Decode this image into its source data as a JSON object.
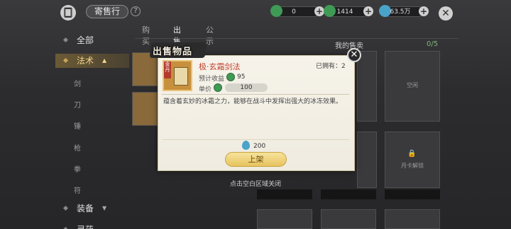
{
  "header": {
    "logo_glyph": "🀆",
    "title": "寄售行",
    "help": "?",
    "currencies": [
      {
        "name": "jade",
        "value": "0",
        "color": "#3f9a56"
      },
      {
        "name": "copper",
        "value": "1414",
        "color": "#3f9a56"
      },
      {
        "name": "spirit-stone",
        "value": "63.5万",
        "color": "#4aa3c9"
      }
    ],
    "plus": "+",
    "close": "✕"
  },
  "sidebar": {
    "all": "全部",
    "spells": "法术",
    "subs": [
      "剑",
      "刀",
      "锤",
      "枪",
      "拳",
      "符"
    ],
    "equipment": "装备",
    "other": "灵药"
  },
  "tabs": [
    "购买",
    "出售",
    "公示"
  ],
  "my_sell_label": "我的售卖",
  "sell_count": "0/5",
  "slot_texts": {
    "unlock_month": "月卡解锁",
    "empty": "空闲"
  },
  "modal": {
    "title": "出售物品",
    "item_badge": "金丹",
    "item_name": "极·玄霜剑法",
    "owned_label": "已拥有：",
    "owned_value": "2",
    "expected_label": "预计收益",
    "expected_value": "95",
    "price_label": "单价",
    "price_value": "100",
    "description": "蕴含着玄妙的冰霜之力，能够在战斗中发挥出强大的冰冻效果。",
    "fee_value": "200",
    "list_button": "上架",
    "close": "✕"
  },
  "hint": "点击空白区域关闭",
  "colors": {
    "accent_gold": "#c9a55a",
    "item_name_red": "#c3402e",
    "coin_green": "#3f9a56",
    "gem_blue": "#4aa3c9"
  }
}
